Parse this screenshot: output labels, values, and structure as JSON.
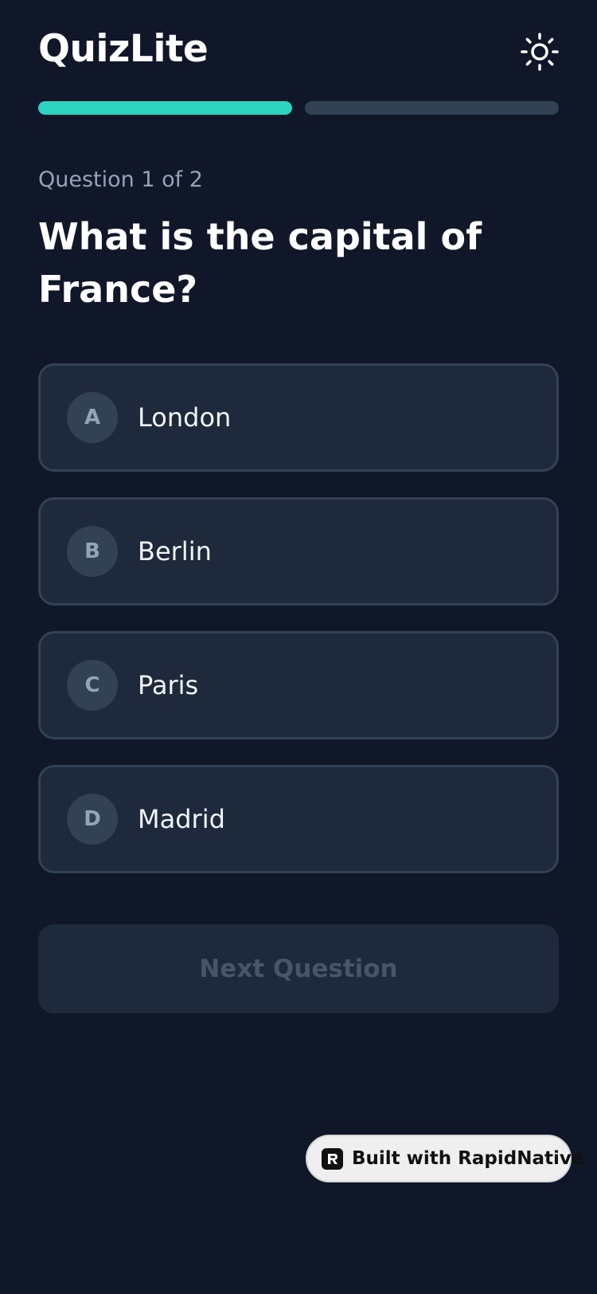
{
  "app": {
    "title": "QuizLite",
    "theme_toggle_icon": "sun-icon"
  },
  "progress": {
    "current": 1,
    "total": 2,
    "segments": [
      {
        "state": "completed",
        "color": "#2dd4bf"
      },
      {
        "state": "pending",
        "color": "#334155"
      }
    ]
  },
  "question": {
    "counter": "Question 1 of 2",
    "text": "What is the capital of France?"
  },
  "options": [
    {
      "letter": "A",
      "text": "London"
    },
    {
      "letter": "B",
      "text": "Berlin"
    },
    {
      "letter": "C",
      "text": "Paris"
    },
    {
      "letter": "D",
      "text": "Madrid"
    }
  ],
  "next_button": {
    "label": "Next Question",
    "enabled": false
  },
  "badge": {
    "label": "Built with RapidNative"
  },
  "colors": {
    "background": "#0f1729",
    "card": "#1e293b",
    "border": "#334155",
    "accent": "#2dd4bf",
    "muted_text": "#94a3b8"
  }
}
